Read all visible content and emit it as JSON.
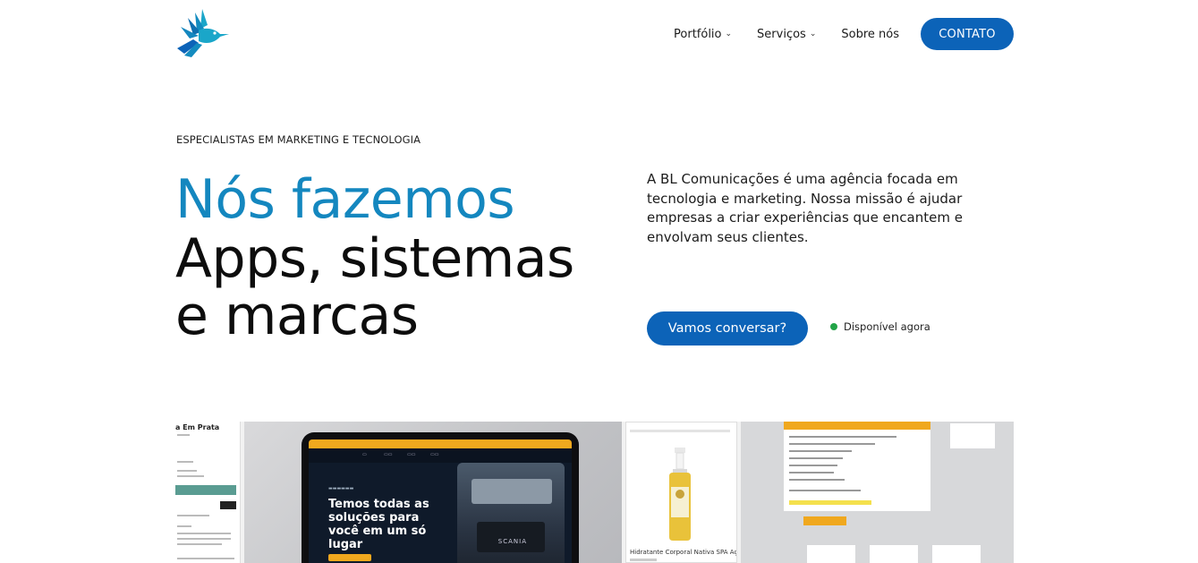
{
  "brand": {
    "logo_icon": "hummingbird-logo",
    "colors": {
      "primary": "#0c63b8",
      "accent": "#1487bf",
      "status": "#22a447"
    }
  },
  "nav": {
    "items": [
      {
        "label": "Portfólio",
        "has_dropdown": true
      },
      {
        "label": "Serviços",
        "has_dropdown": true
      },
      {
        "label": "Sobre nós",
        "has_dropdown": false
      }
    ],
    "cta_label": "CONTATO"
  },
  "hero": {
    "eyebrow": "ESPECIALISTAS EM MARKETING E TECNOLOGIA",
    "headline_accent": "Nós fazemos",
    "headline_line2": "Apps, sistemas",
    "headline_line3": "e marcas",
    "intro": "A BL Comunicações é uma agência focada em tecnologia e marketing. Nossa missão é ajudar empresas a criar experiências que encantem e envolvam seus clientes.",
    "cta_label": "Vamos conversar?",
    "status_label": "Disponível agora"
  },
  "portfolio": {
    "card1_title": "a Em Prata",
    "card2_headline": "Temos todas as soluções para você em um só lugar",
    "card2_brand": "SCANIA",
    "card3_product": "Hidratante Corporal Nativa SPA Açaí"
  }
}
